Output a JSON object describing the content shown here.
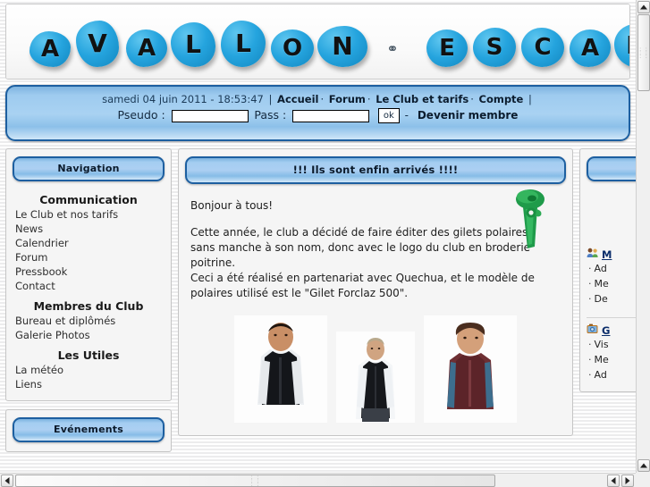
{
  "banner": {
    "alt": "Avallon Escal climbing holds banner",
    "letters": [
      "A",
      "V",
      "A",
      "L",
      "L",
      "O",
      "N",
      "⚭",
      "E",
      "S",
      "C",
      "A",
      "L"
    ],
    "brand_color": "#25a4de"
  },
  "navbar": {
    "datetime": "samedi 04 juin 2011 - 18:53:47",
    "pipe": "|",
    "dot": "·",
    "links": [
      {
        "label": "Accueil"
      },
      {
        "label": "Forum"
      },
      {
        "label": "Le Club et tarifs"
      },
      {
        "label": "Compte"
      }
    ],
    "pseudo_label": "Pseudo :",
    "pseudo_value": "",
    "pseudo_placeholder": "",
    "pass_label": "Pass :",
    "pass_value": "",
    "pass_placeholder": "",
    "ok_label": "ok",
    "separator": "-",
    "become_member": "Devenir membre"
  },
  "sidebar_left": {
    "title": "Navigation",
    "sections": [
      {
        "heading": "Communication",
        "items": [
          {
            "label": "Le Club et nos tarifs"
          },
          {
            "label": "News"
          },
          {
            "label": "Calendrier"
          },
          {
            "label": "Forum"
          },
          {
            "label": "Pressbook"
          },
          {
            "label": "Contact"
          }
        ]
      },
      {
        "heading": "Membres du Club",
        "items": [
          {
            "label": "Bureau et diplômés"
          },
          {
            "label": "Galerie Photos"
          }
        ]
      },
      {
        "heading": "Les Utiles",
        "items": [
          {
            "label": "La météo"
          },
          {
            "label": "Liens"
          }
        ]
      }
    ],
    "events_title": "Evénements"
  },
  "main": {
    "title": "!!! Ils sont enfin arrivés !!!!",
    "paragraphs": [
      "Bonjour à tous!",
      "Cette année, le club a décidé de faire éditer des gilets polaires sans manche à son nom, donc avec le logo du club en broderie poitrine.",
      "Ceci a été réalisé en partenariat avec Quechua, et le modèle de polaires utilisé est le \"Gilet Forclaz 500\"."
    ],
    "photos": [
      {
        "alt": "Homme portant le gilet polaire noir"
      },
      {
        "alt": "Femme portant le gilet polaire noir"
      },
      {
        "alt": "Enfant portant le gilet polaire bordeaux"
      }
    ],
    "decoration_icon": "green-climbing-hold-icon"
  },
  "sidebar_right": {
    "blocks": [
      {
        "icon": "members-icon",
        "heading": "M",
        "items": [
          {
            "label": "Ad"
          },
          {
            "label": "Me"
          },
          {
            "label": "De"
          }
        ]
      },
      {
        "icon": "photo-gallery-icon",
        "heading": "G",
        "items": [
          {
            "label": "Vis"
          },
          {
            "label": "Me"
          },
          {
            "label": "Ad"
          }
        ]
      }
    ]
  },
  "scrollbars": {
    "vertical": {
      "up_arrow": "▲",
      "down_arrow": "▼",
      "grip": "::::"
    },
    "horizontal": {
      "left_arrow": "◄",
      "right_arrow": "►",
      "grip": "::::"
    }
  }
}
